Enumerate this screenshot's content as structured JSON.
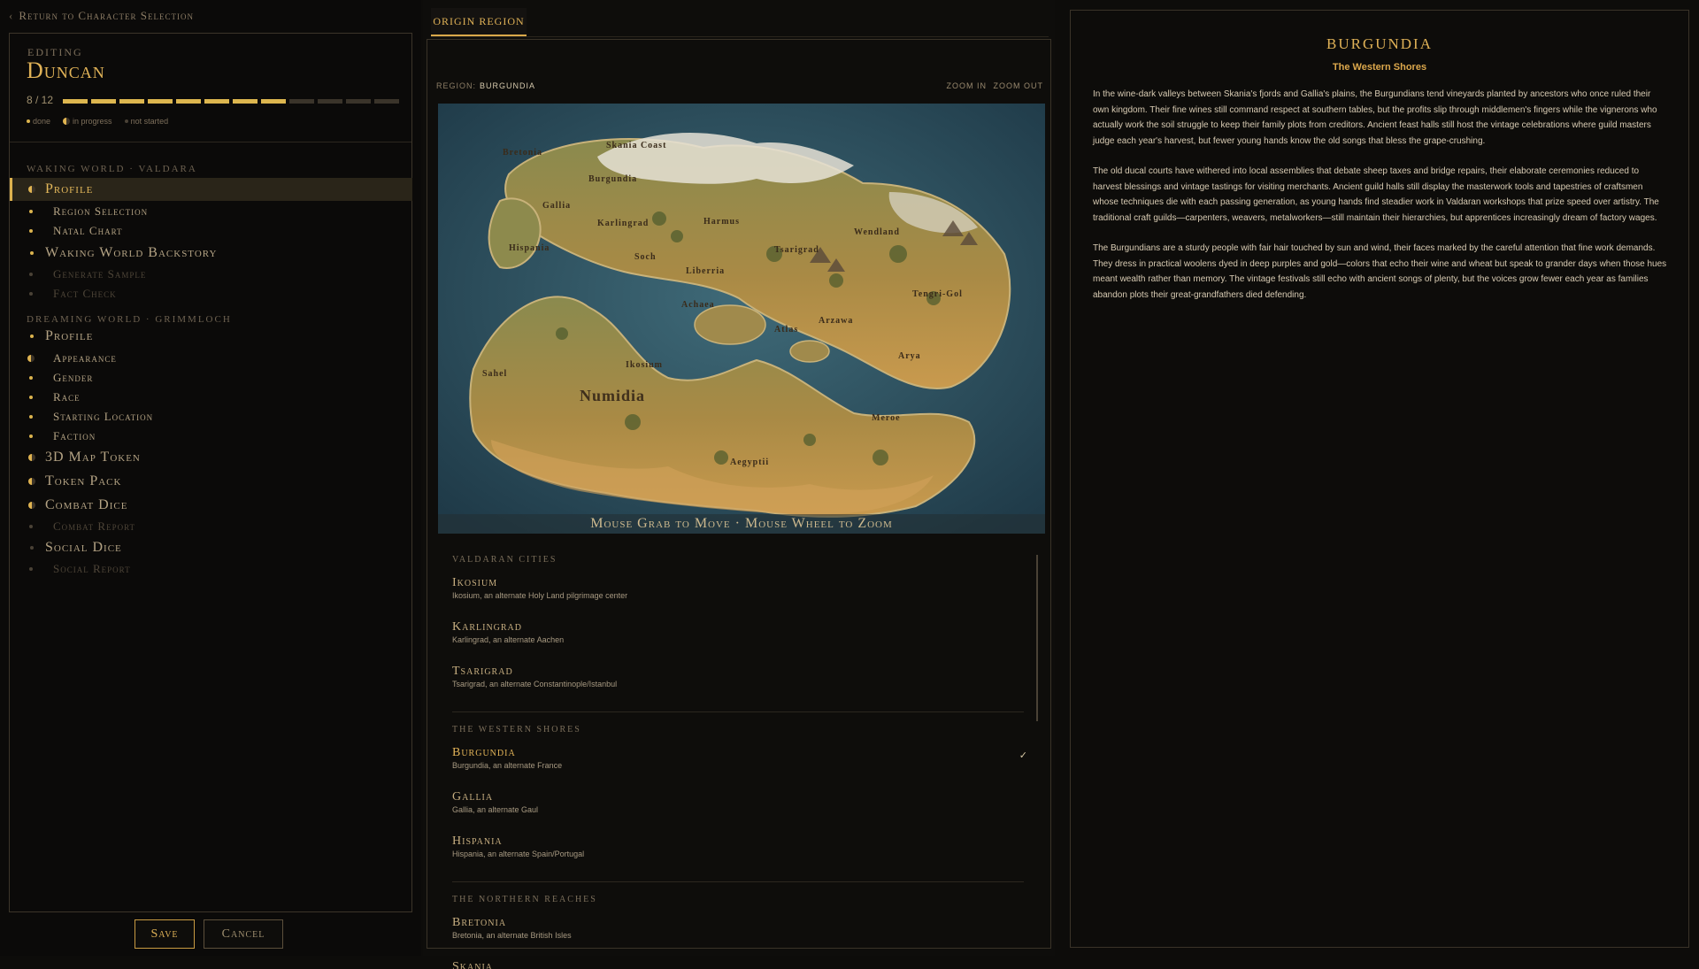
{
  "back_link": "Return to Character Selection",
  "editor": {
    "editing_label": "EDITING",
    "name": "Duncan",
    "progress_text": "8 / 12",
    "progress": {
      "done": 8,
      "total": 12
    },
    "legend": {
      "done": "done",
      "in_progress": "in progress",
      "not_started": "not started"
    }
  },
  "sections": [
    {
      "heading": "WAKING WORLD · VALDARA",
      "items": [
        {
          "label": "Profile",
          "level": "top",
          "status": "in_progress",
          "active": true
        },
        {
          "label": "Region Selection",
          "level": "sub",
          "status": "done"
        },
        {
          "label": "Natal Chart",
          "level": "sub",
          "status": "done"
        },
        {
          "label": "Waking World Backstory",
          "level": "top",
          "status": "done"
        },
        {
          "label": "Generate Sample",
          "level": "sub",
          "status": "not_started"
        },
        {
          "label": "Fact Check",
          "level": "sub",
          "status": "not_started"
        }
      ]
    },
    {
      "heading": "DREAMING WORLD · GRIMMLOCH",
      "items": [
        {
          "label": "Profile",
          "level": "top",
          "status": "done"
        },
        {
          "label": "Appearance",
          "level": "sub",
          "status": "in_progress"
        },
        {
          "label": "Gender",
          "level": "sub",
          "status": "done"
        },
        {
          "label": "Race",
          "level": "sub",
          "status": "done"
        },
        {
          "label": "Starting Location",
          "level": "sub",
          "status": "done"
        },
        {
          "label": "Faction",
          "level": "sub",
          "status": "done"
        },
        {
          "label": "3D Map Token",
          "level": "top",
          "status": "in_progress"
        },
        {
          "label": "Token Pack",
          "level": "top",
          "status": "in_progress"
        },
        {
          "label": "Combat Dice",
          "level": "top",
          "status": "in_progress"
        },
        {
          "label": "Combat Report",
          "level": "sub",
          "status": "not_started"
        },
        {
          "label": "Social Dice",
          "level": "top",
          "status": "not_started"
        },
        {
          "label": "Social Report",
          "level": "sub",
          "status": "not_started"
        }
      ]
    }
  ],
  "buttons": {
    "save": "Save",
    "cancel": "Cancel"
  },
  "center": {
    "tab": "ORIGIN REGION",
    "region_label": "REGION:",
    "region_value": "BURGUNDIA",
    "zoom_in": "ZOOM IN",
    "zoom_out": "ZOOM OUT",
    "map_hint": "Mouse Grab to Move  ·  Mouse Wheel to Zoom",
    "map_labels": [
      "Bretonia",
      "Skania Coast",
      "Burgundia",
      "Gallia",
      "Karlingrad",
      "Hispania",
      "Harmus",
      "Wendland",
      "Soch",
      "Liberria",
      "Tsarigrad",
      "Achaea",
      "Tengri-Gol",
      "Arzawa",
      "Atlas",
      "Arya",
      "Sahel",
      "Numidia",
      "Ikosium",
      "Meroe",
      "Aegyptii"
    ],
    "groups": [
      {
        "heading": "VALDARAN CITIES",
        "cities": [
          {
            "name": "Ikosium",
            "desc": "Ikosium, an alternate Holy Land pilgrimage center"
          },
          {
            "name": "Karlingrad",
            "desc": "Karlingrad, an alternate Aachen"
          },
          {
            "name": "Tsarigrad",
            "desc": "Tsarigrad, an alternate Constantinople/Istanbul"
          }
        ]
      },
      {
        "heading": "THE WESTERN SHORES",
        "cities": [
          {
            "name": "Burgundia",
            "desc": "Burgundia, an alternate France",
            "selected": true
          },
          {
            "name": "Gallia",
            "desc": "Gallia, an alternate Gaul"
          },
          {
            "name": "Hispania",
            "desc": "Hispania, an alternate Spain/Portugal"
          }
        ]
      },
      {
        "heading": "THE NORTHERN REACHES",
        "cities": [
          {
            "name": "Bretonia",
            "desc": "Bretonia, an alternate British Isles"
          },
          {
            "name": "Skania",
            "desc": ""
          }
        ]
      }
    ],
    "check_mark": "✓"
  },
  "detail": {
    "title": "BURGUNDIA",
    "subtitle": "The Western Shores",
    "paragraphs": [
      "In the wine-dark valleys between Skania's fjords and Gallia's plains, the Burgundians tend vineyards planted by ancestors who once ruled their own kingdom. Their fine wines still command respect at southern tables, but the profits slip through middlemen's fingers while the vignerons who actually work the soil struggle to keep their family plots from creditors. Ancient feast halls still host the vintage celebrations where guild masters judge each year's harvest, but fewer young hands know the old songs that bless the grape-crushing.",
      "The old ducal courts have withered into local assemblies that debate sheep taxes and bridge repairs, their elaborate ceremonies reduced to harvest blessings and vintage tastings for visiting merchants. Ancient guild halls still display the masterwork tools and tapestries of craftsmen whose techniques die with each passing generation, as young hands find steadier work in Valdaran workshops that prize speed over artistry. The traditional craft guilds—carpenters, weavers, metalworkers—still maintain their hierarchies, but apprentices increasingly dream of factory wages.",
      "The Burgundians are a sturdy people with fair hair touched by sun and wind, their faces marked by the careful attention that fine work demands. They dress in practical woolens dyed in deep purples and gold—colors that echo their wine and wheat but speak to grander days when those hues meant wealth rather than memory. The vintage festivals still echo with ancient songs of plenty, but the voices grow fewer each year as families abandon plots their great-grandfathers died defending."
    ]
  },
  "colors": {
    "accent": "#e0b257",
    "background": "#0d0c0a",
    "border": "#3a3328"
  }
}
